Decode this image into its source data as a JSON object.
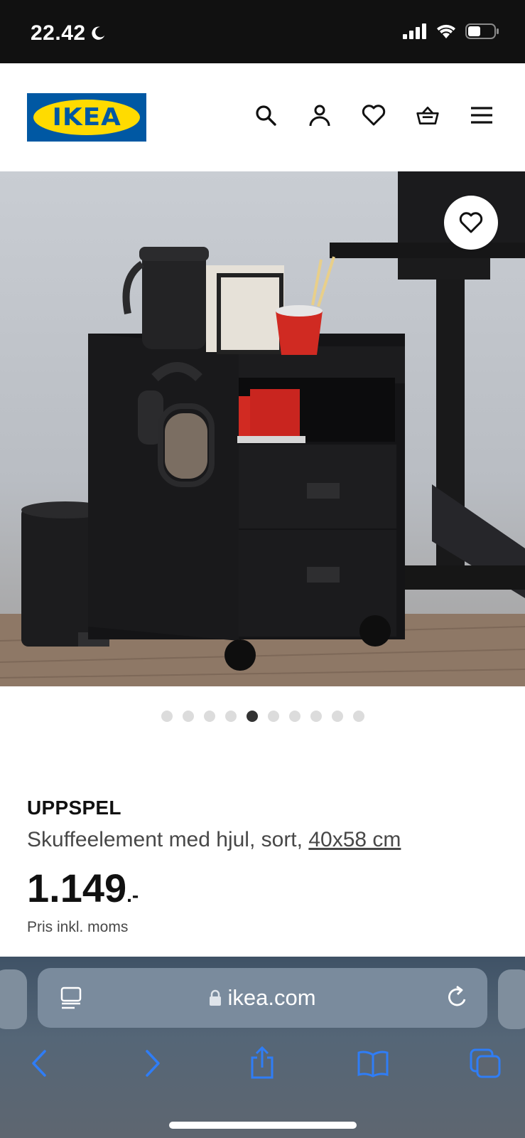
{
  "status": {
    "time": "22.42",
    "icons": [
      "moon-icon",
      "signal-icon",
      "wifi-icon",
      "battery-icon"
    ]
  },
  "header": {
    "logo_text": "IKEA",
    "logo_colors": {
      "blue": "#0058a3",
      "yellow": "#ffdb00"
    },
    "icons": [
      "search-icon",
      "account-icon",
      "heart-icon",
      "basket-icon",
      "menu-icon"
    ]
  },
  "gallery": {
    "image_count": 10,
    "active_index": 4,
    "favourite_icon": "heart-icon"
  },
  "product": {
    "name": "UPPSPEL",
    "description": "Skuffeelement med hjul, sort, ",
    "dimensions": "40x58 cm",
    "price": "1.149",
    "price_suffix": ".-",
    "price_note": "Pris inkl. moms"
  },
  "browser": {
    "url": "ikea.com",
    "icons": [
      "reader-icon",
      "lock-icon",
      "reload-icon",
      "back-icon",
      "forward-icon",
      "share-icon",
      "bookmarks-icon",
      "tabs-icon"
    ],
    "accent": "#2f7df6"
  }
}
